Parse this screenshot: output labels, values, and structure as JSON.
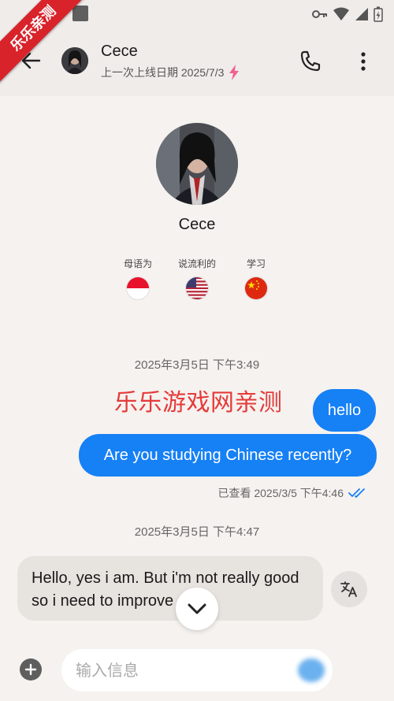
{
  "ribbon": "乐乐亲测",
  "header": {
    "title": "Cece",
    "subtitle": "上一次上线日期 2025/7/3"
  },
  "profile": {
    "name": "Cece",
    "languages": [
      {
        "label": "母语为",
        "flag": "indonesia"
      },
      {
        "label": "说流利的",
        "flag": "usa"
      },
      {
        "label": "学习",
        "flag": "china"
      }
    ]
  },
  "messages": {
    "timestamp1": "2025年3月5日 下午3:49",
    "watermark": "乐乐游戏网亲测",
    "out1": "hello",
    "out2": "Are you studying Chinese recently?",
    "seen": "已查看 2025/3/5 下午4:46",
    "timestamp2": "2025年3月5日 下午4:47",
    "in1": "Hello, yes i am. But i'm not really good so i need to improve"
  },
  "composer": {
    "placeholder": "输入信息"
  },
  "colors": {
    "accent": "#1680f5",
    "background": "#f5f2ef",
    "ribbon": "#d8232a",
    "lightning": "#f06292"
  }
}
